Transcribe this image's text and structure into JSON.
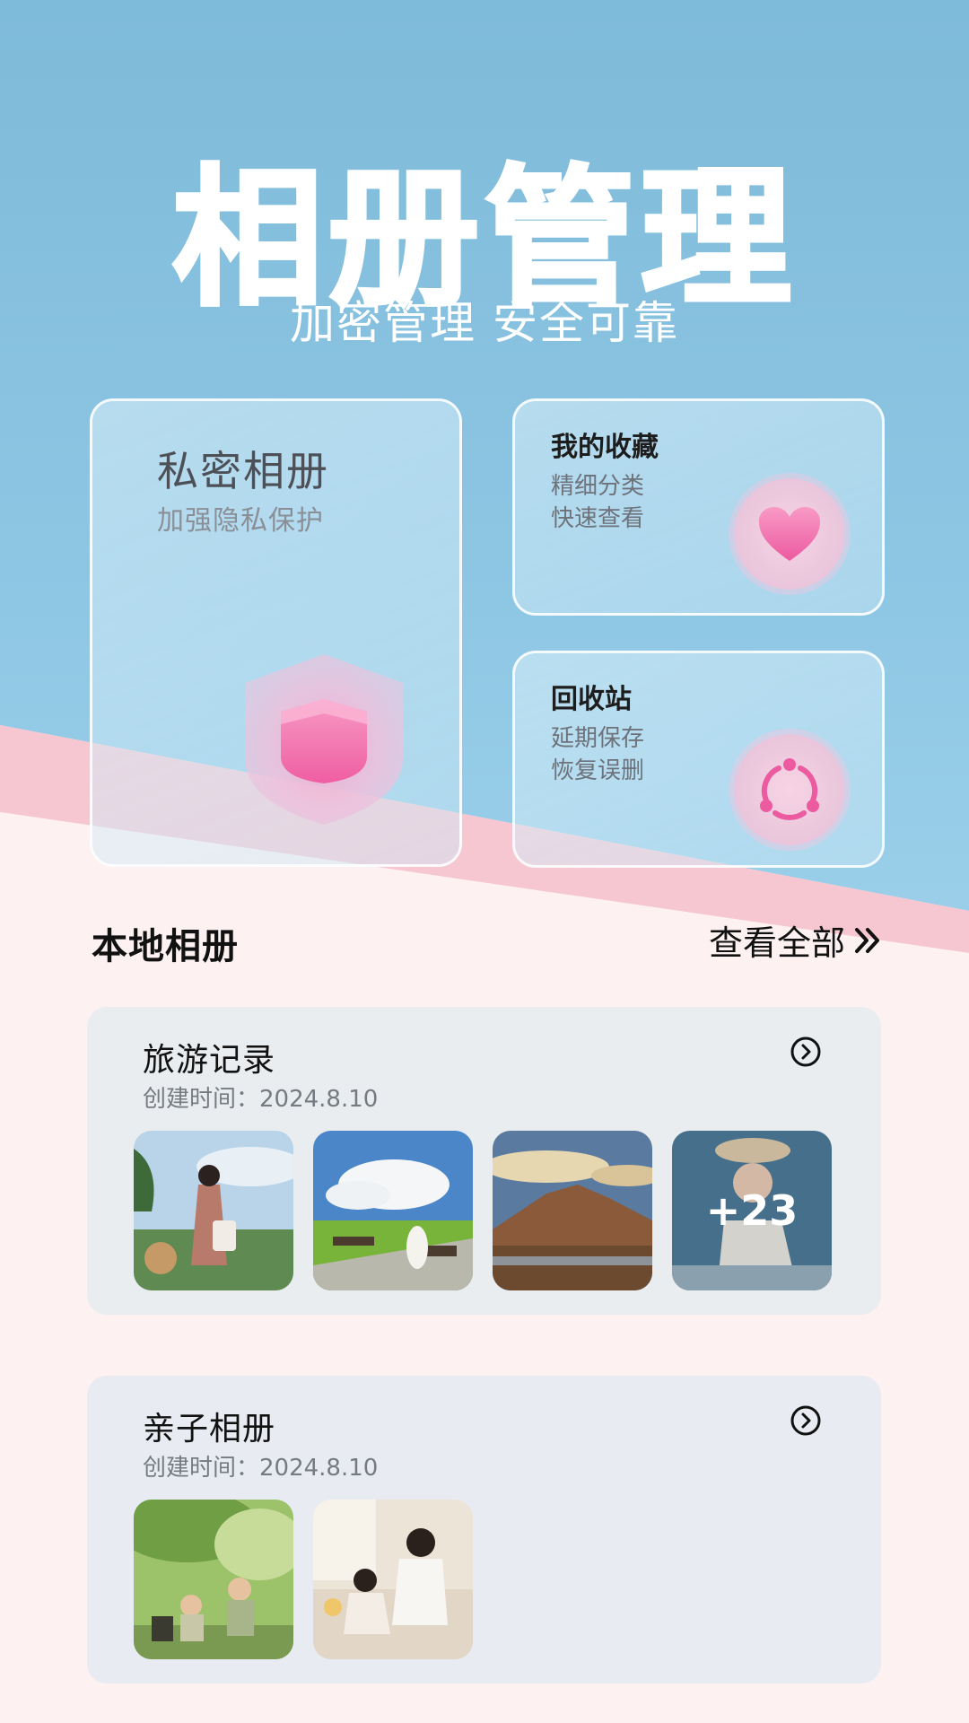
{
  "header": {
    "title": "相册管理",
    "subtitle": "加密管理 安全可靠"
  },
  "cards": {
    "private": {
      "title": "私密相册",
      "subtitle": "加强隐私保护",
      "icon": "shield-icon"
    },
    "favorites": {
      "title": "我的收藏",
      "line1": "精细分类",
      "line2": "快速查看",
      "icon": "heart-icon"
    },
    "recycle": {
      "title": "回收站",
      "line1": "延期保存",
      "line2": "恢复误删",
      "icon": "recycle-icon"
    }
  },
  "section": {
    "title": "本地相册",
    "see_all": "查看全部"
  },
  "albums": [
    {
      "name": "旅游记录",
      "date": "创建时间：2024.8.10",
      "more": "+23"
    },
    {
      "name": "亲子相册",
      "date": "创建时间：2024.8.10"
    }
  ],
  "colors": {
    "accent_pink": "#f06aa8",
    "sky_blue": "#7ebad9"
  }
}
